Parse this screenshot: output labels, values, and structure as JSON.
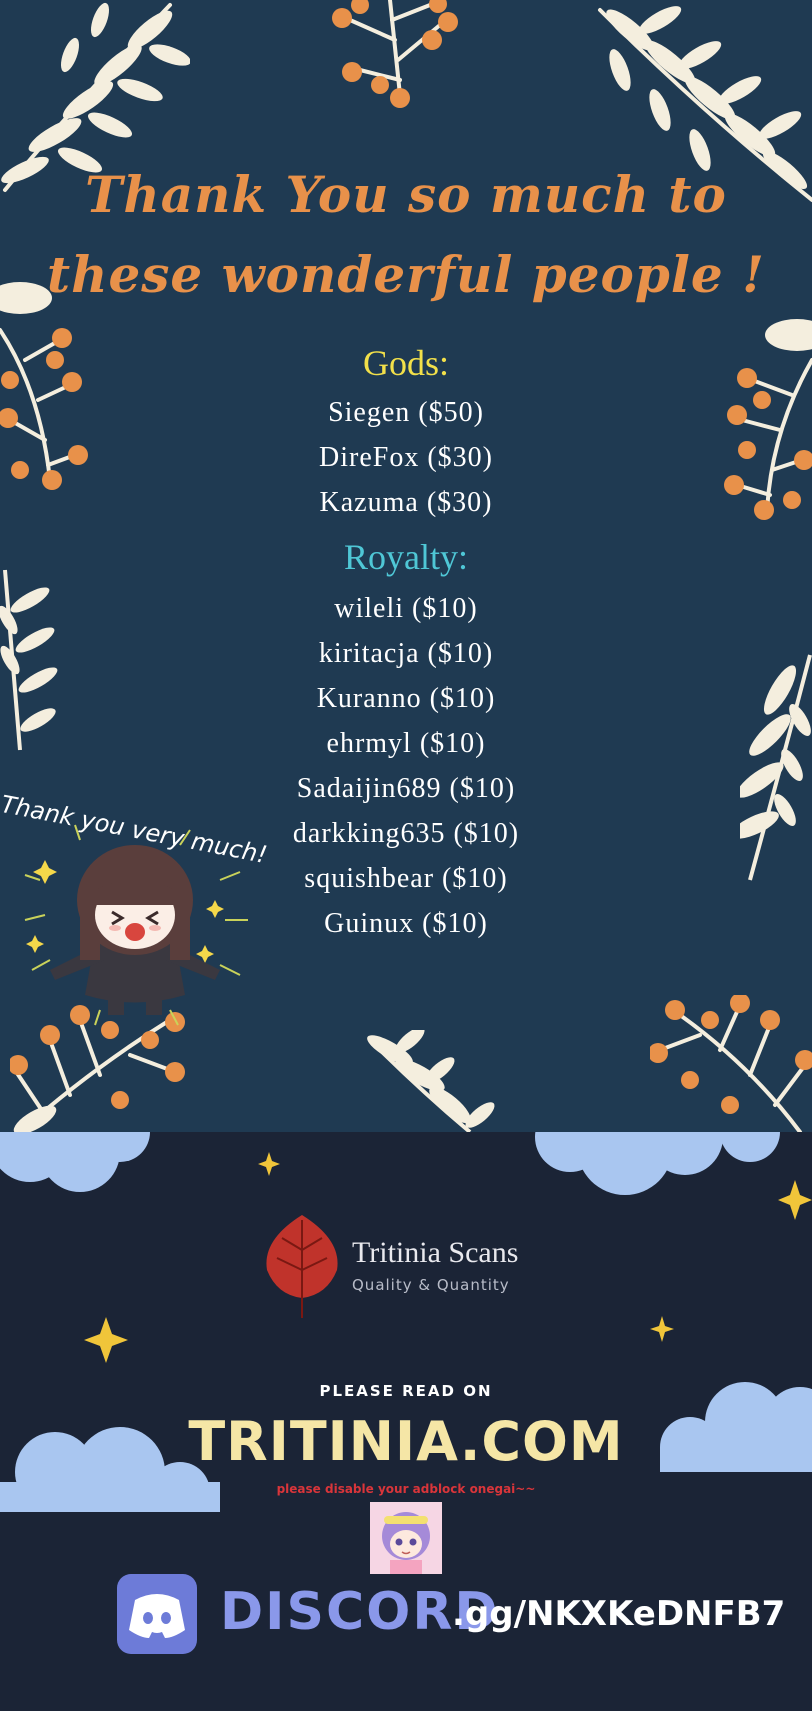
{
  "headline": {
    "line1": "Thank You so much to",
    "line2": "these wonderful people !"
  },
  "gods": {
    "title": "Gods:",
    "members": [
      "Siegen ($50)",
      "DireFox ($30)",
      "Kazuma ($30)"
    ]
  },
  "royalty": {
    "title": "Royalty:",
    "members": [
      "wileli ($10)",
      "kiritacja ($10)",
      "Kuranno ($10)",
      "ehrmyl ($10)",
      "Sadaijin689 ($10)",
      "darkking635 ($10)",
      "squishbear ($10)",
      "Guinux ($10)"
    ]
  },
  "chibi": {
    "caption": "Thank you very much!"
  },
  "brand": {
    "name": "Tritinia Scans",
    "tagline": "Quality & Quantity"
  },
  "promo": {
    "read_on": "PLEASE READ ON",
    "site": "TRITINIA.COM",
    "adblock_note": "please disable your adblock onegai~~"
  },
  "discord": {
    "word": "DISCORD",
    "invite": ".gg/NKXKeDNFB7"
  },
  "colors": {
    "top_background": "#1f3a52",
    "bottom_background": "#1b2436",
    "headline": "#e8914a",
    "gods_title": "#f2e04a",
    "royalty_title": "#4fc7d6",
    "leaf": "#f4eede",
    "berry": "#e8914a",
    "cloud": "#a9c6f0",
    "star": "#f0c53a",
    "brand_leaf": "#c0332b",
    "site": "#f5e6a6",
    "adblock": "#d9353a",
    "discord": "#6d7bd8"
  },
  "icons": [
    "leaf-branch-icon",
    "berry-branch-icon",
    "tritinia-leaf-icon",
    "discord-icon",
    "star-icon",
    "cloud-icon"
  ]
}
